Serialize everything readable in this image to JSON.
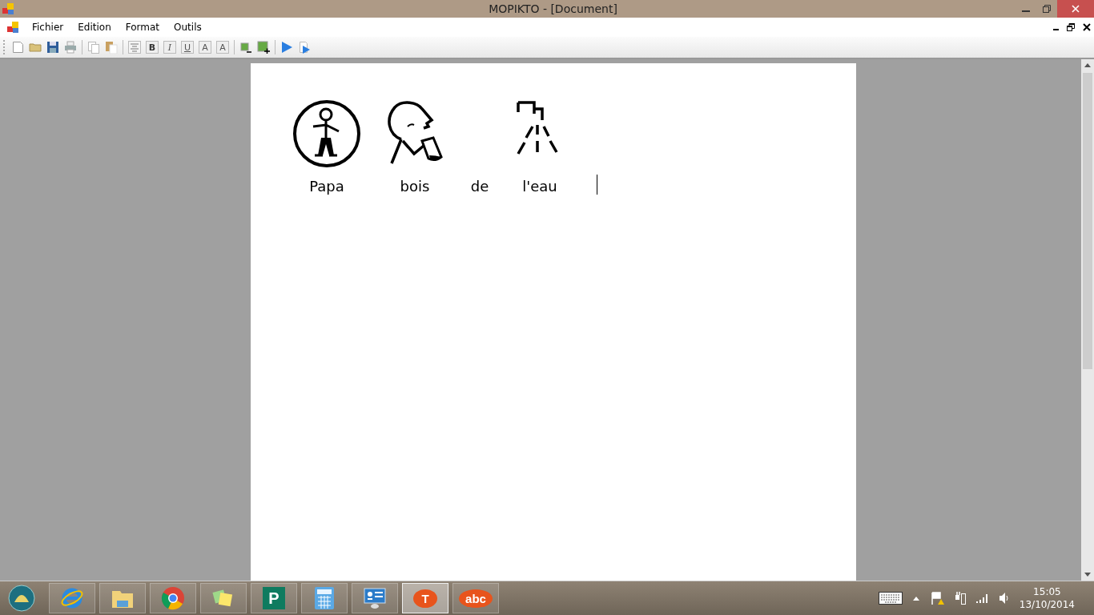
{
  "window": {
    "title": "MOPIKTO - [Document]"
  },
  "menu": [
    "Fichier",
    "Edition",
    "Format",
    "Outils"
  ],
  "toolbar": [
    {
      "kind": "new"
    },
    {
      "kind": "open"
    },
    {
      "kind": "save"
    },
    {
      "kind": "print"
    },
    {
      "kind": "separator"
    },
    {
      "kind": "copy"
    },
    {
      "kind": "paste"
    },
    {
      "kind": "separator"
    },
    {
      "kind": "align"
    },
    {
      "kind": "bold",
      "glyph": "B"
    },
    {
      "kind": "italic",
      "glyph": "I"
    },
    {
      "kind": "underline",
      "glyph": "U"
    },
    {
      "kind": "size",
      "glyph": "A"
    },
    {
      "kind": "size",
      "glyph": "A"
    },
    {
      "kind": "separator"
    },
    {
      "kind": "image-remove"
    },
    {
      "kind": "image-add"
    },
    {
      "kind": "separator"
    },
    {
      "kind": "play"
    },
    {
      "kind": "play-page"
    }
  ],
  "document": {
    "words": [
      {
        "text": "Papa",
        "kind": "person"
      },
      {
        "text": "bois",
        "kind": "drinking"
      },
      {
        "text": "de",
        "kind": "plain"
      },
      {
        "text": "l'eau",
        "kind": "tap"
      }
    ]
  },
  "taskbar": {
    "apps": [
      {
        "kind": "browser-e",
        "selected": false
      },
      {
        "kind": "folder",
        "selected": false
      },
      {
        "kind": "browser-round",
        "selected": false
      },
      {
        "kind": "notes",
        "selected": false
      },
      {
        "kind": "publisher",
        "glyph": "P",
        "selected": false
      },
      {
        "kind": "calculator",
        "selected": false
      },
      {
        "kind": "panel",
        "selected": false
      },
      {
        "kind": "bubble",
        "glyph": "T",
        "selected": true
      },
      {
        "kind": "bubble",
        "glyph": "abc",
        "selected": false
      }
    ],
    "clock": {
      "time": "15:05",
      "date": "13/10/2014"
    }
  }
}
